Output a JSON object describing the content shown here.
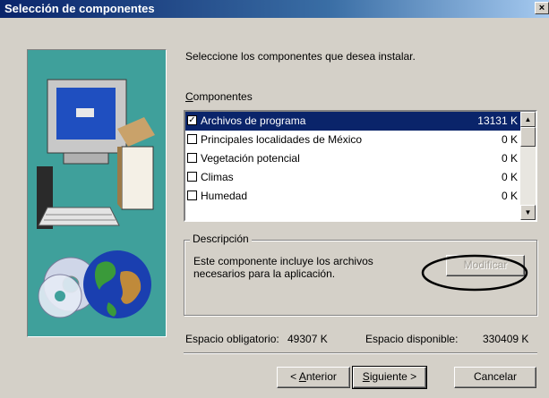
{
  "window": {
    "title": "Selección de componentes",
    "close_glyph": "×"
  },
  "instruction": "Seleccione los componentes que desea instalar.",
  "components": {
    "label_prefix": "C",
    "label_rest": "omponentes",
    "items": [
      {
        "name": "Archivos de programa",
        "size": "13131 K",
        "checked": true,
        "selected": true
      },
      {
        "name": "Principales localidades de México",
        "size": "0 K",
        "checked": false,
        "selected": false
      },
      {
        "name": "Vegetación potencial",
        "size": "0 K",
        "checked": false,
        "selected": false
      },
      {
        "name": "Climas",
        "size": "0 K",
        "checked": false,
        "selected": false
      },
      {
        "name": "Humedad",
        "size": "0 K",
        "checked": false,
        "selected": false
      }
    ]
  },
  "description": {
    "title": "Descripción",
    "text": "Este componente incluye los archivos necesarios para la aplicación.",
    "modify_button": "Modificar",
    "modify_enabled": false
  },
  "space": {
    "required_label": "Espacio obligatorio:",
    "required_value": "49307 K",
    "available_label": "Espacio disponible:",
    "available_value": "330409 K"
  },
  "buttons": {
    "back_prefix": "< ",
    "back_key": "A",
    "back_rest": "nterior",
    "next_key": "S",
    "next_rest": "iguiente >",
    "cancel": "Cancelar"
  },
  "colors": {
    "selection": "#0a246a",
    "art_background": "#3fa09b",
    "annotation": "#000000"
  }
}
